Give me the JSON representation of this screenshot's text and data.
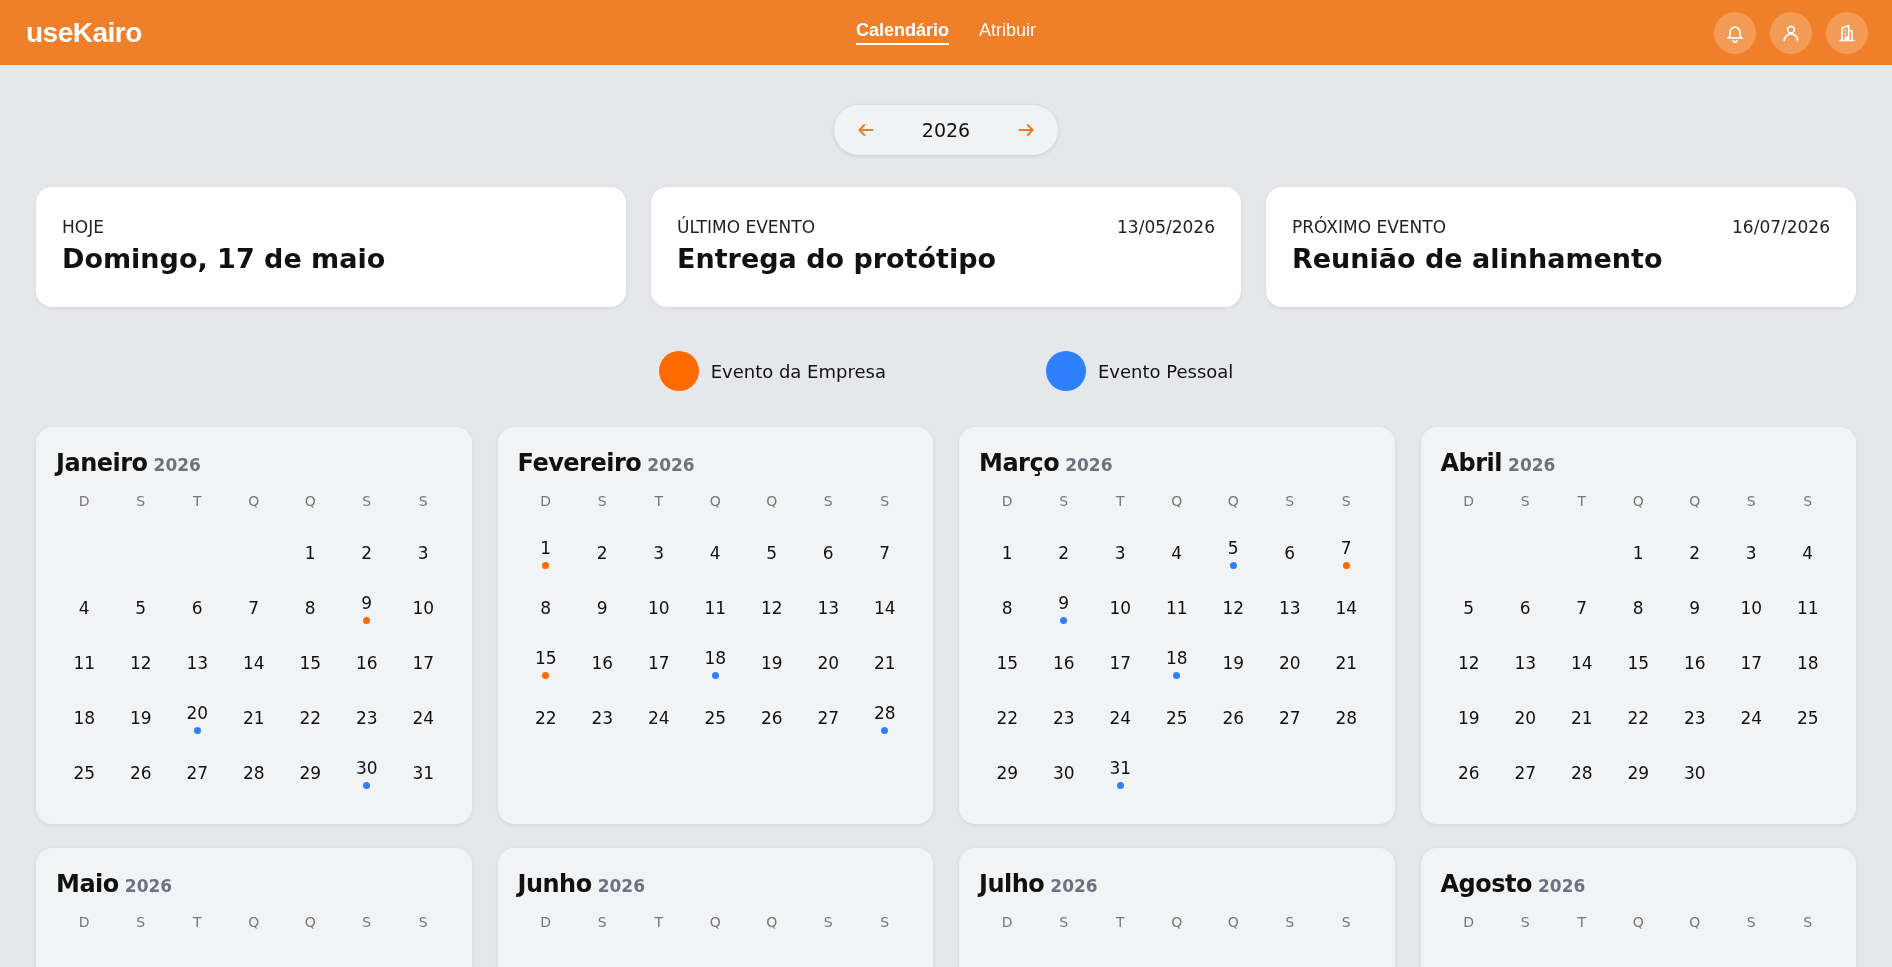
{
  "header": {
    "logo": "useKairo",
    "nav": [
      {
        "label": "Calendário",
        "selected": true
      },
      {
        "label": "Atribuir",
        "selected": false
      }
    ]
  },
  "year_nav": {
    "year": "2026"
  },
  "summary": [
    {
      "title": "HOJE",
      "value": "Domingo, 17 de maio"
    },
    {
      "title": "ÚLTIMO EVENTO",
      "date": "13/05/2026",
      "value": "Entrega do protótipo"
    },
    {
      "title": "PRÓXIMO EVENTO",
      "date": "16/07/2026",
      "value": "Reunião de alinhamento"
    }
  ],
  "legend": [
    {
      "kind": "company",
      "label": "Evento da Empresa",
      "color": "#ff6a00"
    },
    {
      "kind": "personal",
      "label": "Evento Pessoal",
      "color": "#2f80ff"
    }
  ],
  "months": [
    {
      "name": "Janeiro",
      "year": "2026",
      "weekdays": [
        "D",
        "S",
        "T",
        "Q",
        "Q",
        "S",
        "S"
      ],
      "days": [
        {
          "label": "1",
          "kind": "plain"
        },
        {
          "label": "2",
          "kind": "plain"
        },
        {
          "label": "3",
          "kind": "plain"
        },
        {
          "label": "4",
          "kind": "plain"
        },
        {
          "label": "5",
          "kind": "plain"
        },
        {
          "label": "6",
          "kind": "plain"
        },
        {
          "label": "7",
          "kind": "plain"
        },
        {
          "label": "8",
          "kind": "plain"
        },
        {
          "label": "9",
          "kind": "company"
        },
        {
          "label": "10",
          "kind": "plain"
        },
        {
          "label": "11",
          "kind": "plain"
        },
        {
          "label": "12",
          "kind": "plain"
        },
        {
          "label": "13",
          "kind": "plain"
        },
        {
          "label": "14",
          "kind": "plain"
        },
        {
          "label": "15",
          "kind": "plain"
        },
        {
          "label": "16",
          "kind": "plain"
        },
        {
          "label": "17",
          "kind": "plain"
        },
        {
          "label": "18",
          "kind": "plain"
        },
        {
          "label": "19",
          "kind": "plain"
        },
        {
          "label": "20",
          "kind": "personal"
        },
        {
          "label": "21",
          "kind": "plain"
        },
        {
          "label": "22",
          "kind": "plain"
        },
        {
          "label": "23",
          "kind": "plain"
        },
        {
          "label": "24",
          "kind": "plain"
        },
        {
          "label": "25",
          "kind": "plain"
        },
        {
          "label": "26",
          "kind": "plain"
        },
        {
          "label": "27",
          "kind": "plain"
        },
        {
          "label": "28",
          "kind": "plain"
        },
        {
          "label": "29",
          "kind": "plain"
        },
        {
          "label": "30",
          "kind": "personal"
        },
        {
          "label": "31",
          "kind": "plain"
        }
      ]
    },
    {
      "name": "Fevereiro",
      "year": "2026",
      "weekdays": [
        "D",
        "S",
        "T",
        "Q",
        "Q",
        "S",
        "S"
      ],
      "days": [
        {
          "label": "1",
          "kind": "company"
        },
        {
          "label": "2",
          "kind": "plain"
        },
        {
          "label": "3",
          "kind": "plain"
        },
        {
          "label": "4",
          "kind": "plain"
        },
        {
          "label": "5",
          "kind": "plain"
        },
        {
          "label": "6",
          "kind": "plain"
        },
        {
          "label": "7",
          "kind": "plain"
        },
        {
          "label": "8",
          "kind": "plain"
        },
        {
          "label": "9",
          "kind": "plain"
        },
        {
          "label": "10",
          "kind": "plain"
        },
        {
          "label": "11",
          "kind": "plain"
        },
        {
          "label": "12",
          "kind": "plain"
        },
        {
          "label": "13",
          "kind": "plain"
        },
        {
          "label": "14",
          "kind": "plain"
        },
        {
          "label": "15",
          "kind": "company"
        },
        {
          "label": "16",
          "kind": "plain"
        },
        {
          "label": "17",
          "kind": "plain"
        },
        {
          "label": "18",
          "kind": "personal"
        },
        {
          "label": "19",
          "kind": "plain"
        },
        {
          "label": "20",
          "kind": "plain"
        },
        {
          "label": "21",
          "kind": "plain"
        },
        {
          "label": "22",
          "kind": "plain"
        },
        {
          "label": "23",
          "kind": "plain"
        },
        {
          "label": "24",
          "kind": "plain"
        },
        {
          "label": "25",
          "kind": "plain"
        },
        {
          "label": "26",
          "kind": "plain"
        },
        {
          "label": "27",
          "kind": "plain"
        },
        {
          "label": "28",
          "kind": "personal"
        }
      ]
    },
    {
      "name": "Março",
      "year": "2026",
      "weekdays": [
        "D",
        "S",
        "T",
        "Q",
        "Q",
        "S",
        "S"
      ],
      "days": [
        {
          "label": "1",
          "kind": "plain"
        },
        {
          "label": "2",
          "kind": "plain"
        },
        {
          "label": "3",
          "kind": "plain"
        },
        {
          "label": "4",
          "kind": "plain"
        },
        {
          "label": "5",
          "kind": "personal"
        },
        {
          "label": "6",
          "kind": "plain"
        },
        {
          "label": "7",
          "kind": "company"
        },
        {
          "label": "8",
          "kind": "plain"
        },
        {
          "label": "9",
          "kind": "personal"
        },
        {
          "label": "10",
          "kind": "plain"
        },
        {
          "label": "11",
          "kind": "plain"
        },
        {
          "label": "12",
          "kind": "plain"
        },
        {
          "label": "13",
          "kind": "plain"
        },
        {
          "label": "14",
          "kind": "plain"
        },
        {
          "label": "15",
          "kind": "plain"
        },
        {
          "label": "16",
          "kind": "plain"
        },
        {
          "label": "17",
          "kind": "plain"
        },
        {
          "label": "18",
          "kind": "personal"
        },
        {
          "label": "19",
          "kind": "plain"
        },
        {
          "label": "20",
          "kind": "plain"
        },
        {
          "label": "21",
          "kind": "plain"
        },
        {
          "label": "22",
          "kind": "plain"
        },
        {
          "label": "23",
          "kind": "plain"
        },
        {
          "label": "24",
          "kind": "plain"
        },
        {
          "label": "25",
          "kind": "plain"
        },
        {
          "label": "26",
          "kind": "plain"
        },
        {
          "label": "27",
          "kind": "plain"
        },
        {
          "label": "28",
          "kind": "plain"
        },
        {
          "label": "29",
          "kind": "plain"
        },
        {
          "label": "30",
          "kind": "plain"
        },
        {
          "label": "31",
          "kind": "personal"
        }
      ]
    },
    {
      "name": "Abril",
      "year": "2026",
      "weekdays": [
        "D",
        "S",
        "T",
        "Q",
        "Q",
        "S",
        "S"
      ],
      "days": [
        {
          "label": "1",
          "kind": "plain"
        },
        {
          "label": "2",
          "kind": "plain"
        },
        {
          "label": "3",
          "kind": "plain"
        },
        {
          "label": "4",
          "kind": "plain"
        },
        {
          "label": "5",
          "kind": "plain"
        },
        {
          "label": "6",
          "kind": "plain"
        },
        {
          "label": "7",
          "kind": "plain"
        },
        {
          "label": "8",
          "kind": "plain"
        },
        {
          "label": "9",
          "kind": "plain"
        },
        {
          "label": "10",
          "kind": "plain"
        },
        {
          "label": "11",
          "kind": "plain"
        },
        {
          "label": "12",
          "kind": "plain"
        },
        {
          "label": "13",
          "kind": "plain"
        },
        {
          "label": "14",
          "kind": "plain"
        },
        {
          "label": "15",
          "kind": "plain"
        },
        {
          "label": "16",
          "kind": "plain"
        },
        {
          "label": "17",
          "kind": "plain"
        },
        {
          "label": "18",
          "kind": "plain"
        },
        {
          "label": "19",
          "kind": "plain"
        },
        {
          "label": "20",
          "kind": "plain"
        },
        {
          "label": "21",
          "kind": "plain"
        },
        {
          "label": "22",
          "kind": "plain"
        },
        {
          "label": "23",
          "kind": "plain"
        },
        {
          "label": "24",
          "kind": "plain"
        },
        {
          "label": "25",
          "kind": "plain"
        },
        {
          "label": "26",
          "kind": "plain"
        },
        {
          "label": "27",
          "kind": "plain"
        },
        {
          "label": "28",
          "kind": "plain"
        },
        {
          "label": "29",
          "kind": "plain"
        },
        {
          "label": "30",
          "kind": "plain"
        }
      ]
    },
    {
      "name": "Maio",
      "year": "2026",
      "weekdays": [
        "D",
        "S",
        "T",
        "Q",
        "Q",
        "S",
        "S"
      ]
    },
    {
      "name": "Junho",
      "year": "2026",
      "weekdays": [
        "D",
        "S",
        "T",
        "Q",
        "Q",
        "S",
        "S"
      ]
    },
    {
      "name": "Julho",
      "year": "2026",
      "weekdays": [
        "D",
        "S",
        "T",
        "Q",
        "Q",
        "S",
        "S"
      ]
    },
    {
      "name": "Agosto",
      "year": "2026",
      "weekdays": [
        "D",
        "S",
        "T",
        "Q",
        "Q",
        "S",
        "S"
      ]
    }
  ]
}
